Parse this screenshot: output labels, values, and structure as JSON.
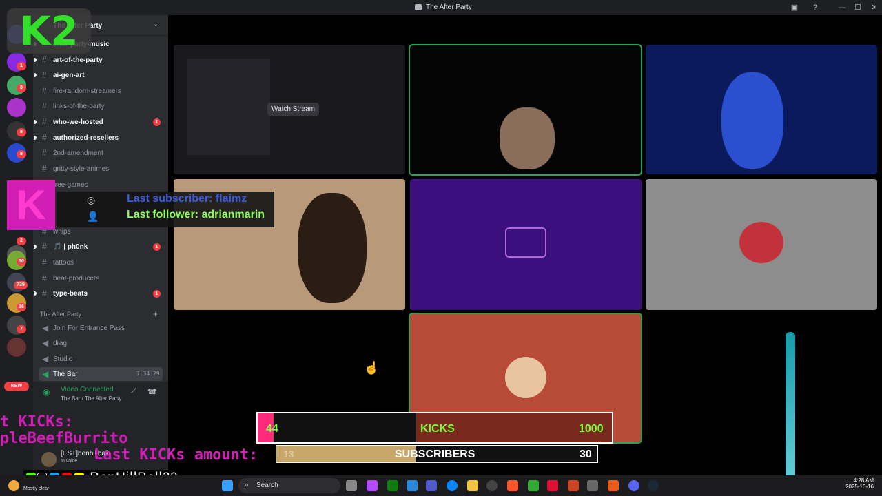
{
  "window": {
    "title": "The After Party"
  },
  "server": {
    "name": "The After Party",
    "new_label": "NEW",
    "badges": [
      "1",
      "8",
      "1",
      "8",
      "8",
      "2",
      "30",
      "739",
      "16",
      "7"
    ]
  },
  "channels": [
    {
      "name": "after-party-music",
      "unread": true,
      "badge": ""
    },
    {
      "name": "art-of-the-party",
      "unread": true,
      "badge": ""
    },
    {
      "name": "ai-gen-art",
      "unread": true,
      "badge": ""
    },
    {
      "name": "fire-random-streamers",
      "unread": false,
      "badge": ""
    },
    {
      "name": "links-of-the-party",
      "unread": false,
      "badge": ""
    },
    {
      "name": "who-we-hosted",
      "unread": true,
      "badge": "1"
    },
    {
      "name": "authorized-resellers",
      "unread": true,
      "badge": ""
    },
    {
      "name": "2nd-amendment",
      "unread": false,
      "badge": ""
    },
    {
      "name": "gritty-style-animes",
      "unread": false,
      "badge": ""
    },
    {
      "name": "free-games",
      "unread": false,
      "badge": ""
    },
    {
      "name": "whips",
      "unread": false,
      "badge": ""
    },
    {
      "name": "🎵 | ph0nk",
      "unread": true,
      "badge": "1"
    },
    {
      "name": "tattoos",
      "unread": false,
      "badge": ""
    },
    {
      "name": "beat-producers",
      "unread": false,
      "badge": ""
    },
    {
      "name": "type-beats",
      "unread": true,
      "badge": "1"
    }
  ],
  "voice_category": "The After Party",
  "voice_channels": [
    {
      "name": "Join For Entrance Pass"
    },
    {
      "name": "drag"
    },
    {
      "name": "Studio"
    },
    {
      "name": "The Bar",
      "time": "7:34:29"
    }
  ],
  "voice_status": {
    "connected": "Video Connected",
    "location": "The Bar / The After Party"
  },
  "user": {
    "name": "[EST]benhillball",
    "status": "In voice"
  },
  "stage": {
    "watch_stream": "Watch Stream"
  },
  "overlay": {
    "logo_text": "K2",
    "k_text": "K",
    "last_subscriber": "Last subscriber: flaimz",
    "last_follower": "Last follower: adrianmarin",
    "kicks_current": "44",
    "kicks_label": "KICKS",
    "kicks_goal": "1000",
    "kicks_progress": 0.044,
    "subs_current": "13",
    "subs_label": "SUBSCRIBERS",
    "subs_goal": "30",
    "subs_progress": 0.433,
    "scroll_line1": "t KICKs:",
    "scroll_line2": "pleBeefBurrito",
    "scroll_line3": "Last KICKs amount:",
    "handle": "BenHillBall22"
  },
  "taskbar": {
    "search_label": "Search",
    "weather": "Mostly clear",
    "time": "4:28 AM",
    "date": "2025-10-16"
  },
  "colors": {
    "discord_bg": "#2b2d31",
    "speaking_outline": "#23a55a",
    "kick_green": "#7cff3c",
    "pink": "#ff2b7a"
  }
}
